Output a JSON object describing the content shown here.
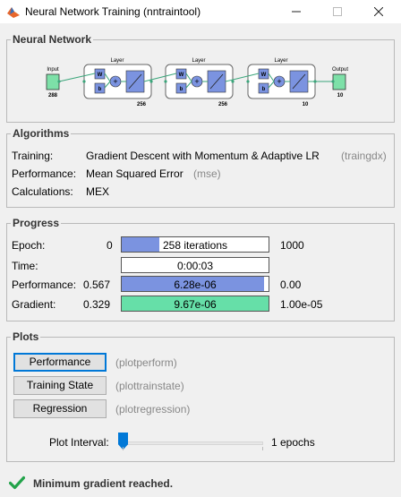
{
  "window": {
    "title": "Neural Network Training (nntraintool)"
  },
  "network": {
    "section_title": "Neural Network",
    "input_label": "Input",
    "input_size": "288",
    "output_label": "Output",
    "output_size": "10",
    "layer_label": "Layer",
    "weight_label": "W",
    "bias_label": "b",
    "layers": [
      {
        "size": "256"
      },
      {
        "size": "256"
      },
      {
        "size": "10"
      }
    ]
  },
  "algorithms": {
    "section_title": "Algorithms",
    "training_label": "Training:",
    "training_value": "Gradient Descent with Momentum & Adaptive LR",
    "training_code": "(traingdx)",
    "performance_label": "Performance:",
    "performance_value": "Mean Squared Error",
    "performance_code": "(mse)",
    "calculations_label": "Calculations:",
    "calculations_value": "MEX"
  },
  "progress": {
    "section_title": "Progress",
    "epoch": {
      "label": "Epoch:",
      "start": "0",
      "value": "258 iterations",
      "end": "1000",
      "fraction": 0.258
    },
    "time": {
      "label": "Time:",
      "value": "0:00:03"
    },
    "performance": {
      "label": "Performance:",
      "start": "0.567",
      "value": "6.28e-06",
      "end": "0.00",
      "fraction": 0.97
    },
    "gradient": {
      "label": "Gradient:",
      "start": "0.329",
      "value": "9.67e-06",
      "end": "1.00e-05",
      "fraction": 1.0
    }
  },
  "plots": {
    "section_title": "Plots",
    "buttons": [
      {
        "label": "Performance",
        "code": "(plotperform)"
      },
      {
        "label": "Training State",
        "code": "(plottrainstate)"
      },
      {
        "label": "Regression",
        "code": "(plotregression)"
      }
    ],
    "interval_label": "Plot Interval:",
    "interval_value": "1 epochs"
  },
  "status": {
    "message": "Minimum gradient reached."
  },
  "colors": {
    "bar_blue": "#7b93e0",
    "bar_green": "#66dfa8",
    "status_green": "#22a34a"
  }
}
